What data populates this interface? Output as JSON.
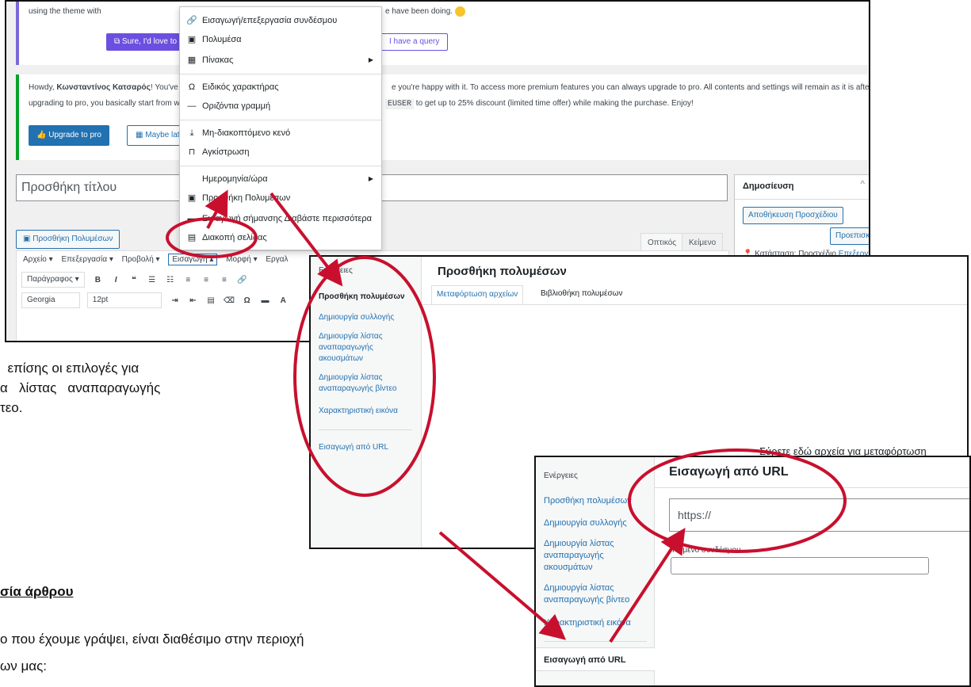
{
  "document": {
    "para1_lines": [
      "  επίσης οι επιλογές για",
      "α   λίστας   αναπαραγωγής",
      "τεο."
    ],
    "heading": "σία άρθρου",
    "para2_lines": [
      "ο που έχουμε γράψει, είναι διαθέσιμο στην περιοχή",
      "ων μας:"
    ]
  },
  "editor": {
    "notice1": {
      "text": "using the theme with",
      "text_right": "e have been doing.",
      "btn_sure": "Sure, I'd love to",
      "btn_query": "I have a query"
    },
    "notice2": {
      "line1_a": "Howdy, ",
      "line1_name": "Κωνσταντίνος Κατσαρός",
      "line1_b": "! You've b",
      "line1_right": "e you're happy with it. To access more premium features you can always upgrade to pro. All contents and settings will remain as it is after",
      "line2_a": "upgrading to pro, you basically start from w",
      "line2_code": "EUSER",
      "line2_right": " to get up to 25% discount (limited time offer) while making the purchase. Enjoy!",
      "btn_upgrade": "Upgrade to pro",
      "btn_later": "Maybe lat"
    },
    "title_placeholder": "Προσθήκη τίτλου",
    "add_media": "Προσθήκη Πολυμέσων",
    "tab_visual": "Οπτικός",
    "tab_text": "Κείμενο",
    "menubar": [
      "Αρχείο ▾",
      "Επεξεργασία ▾",
      "Προβολή ▾",
      "Εισαγωγή ▴",
      "Μορφή ▾",
      "Εργαλ"
    ],
    "toolbar1_select": "Παράγραφος ▾",
    "toolbar2_font": "Georgia",
    "toolbar2_size": "12pt",
    "publish": {
      "title": "Δημοσίευση",
      "save_draft": "Αποθήκευση Προσχέδιου",
      "preview": "Προεπισκό",
      "status_label": "Κατάσταση: Προσχέδιο",
      "status_link": "Επεξεργ"
    },
    "insert_menu": {
      "items": [
        {
          "icon": "🔗",
          "label": "Εισαγωγή/επεξεργασία συνδέσμου"
        },
        {
          "icon": "▣",
          "label": "Πολυμέσα"
        },
        {
          "icon": "▦",
          "label": "Πίνακας"
        },
        {
          "icon": "Ω",
          "label": "Ειδικός χαρακτήρας"
        },
        {
          "icon": "—",
          "label": "Οριζόντια γραμμή"
        },
        {
          "icon": "⤓",
          "label": "Μη-διακοπτόμενο κενό"
        },
        {
          "icon": "⊓",
          "label": "Αγκίστρωση"
        },
        {
          "icon": "",
          "label": "Ημερομηνία/ώρα"
        },
        {
          "icon": "▣",
          "label": "Προσθήκη Πολυμέσων"
        },
        {
          "icon": "▬",
          "label": "Εισαγωγή σήμανσης Διαβάστε περισσότερα"
        },
        {
          "icon": "▤",
          "label": "Διακοπή σελίδας"
        }
      ]
    }
  },
  "media_modal": {
    "sidebar_head": "Ενέργειες",
    "sidebar_items": [
      "Προσθήκη πολυμέσων",
      "Δημιουργία συλλογής",
      "Δημιουργία λίστας αναπαραγωγής ακουσμάτων",
      "Δημιουργία λίστας αναπαραγωγής βίντεο",
      "Χαρακτηριστική εικόνα",
      "Εισαγωγή από URL"
    ],
    "title": "Προσθήκη πολυμέσων",
    "tab_upload": "Μεταφόρτωση αρχείων",
    "tab_library": "Βιβλιοθήκη πολυμέσων",
    "drop_text": "Σύρετε εδώ αρχεία για μεταφόρτωση"
  },
  "url_modal": {
    "sidebar_head": "Ενέργειες",
    "sidebar_items": [
      "Προσθήκη πολυμέσων",
      "Δημιουργία συλλογής",
      "Δημιουργία λίστας αναπαραγωγής ακουσμάτων",
      "Δημιουργία λίστας αναπαραγωγής βίντεο",
      "Χαρακτηριστική εικόνα",
      "Εισαγωγή από URL"
    ],
    "title": "Εισαγωγή από URL",
    "url_value": "https://",
    "link_text_label": "Κείμενο συνδέσμου"
  },
  "colors": {
    "annotation_red": "#c8102e",
    "wp_blue": "#2271b1",
    "notice_purple": "#6c4fe0",
    "notice_green": "#00a32a"
  }
}
